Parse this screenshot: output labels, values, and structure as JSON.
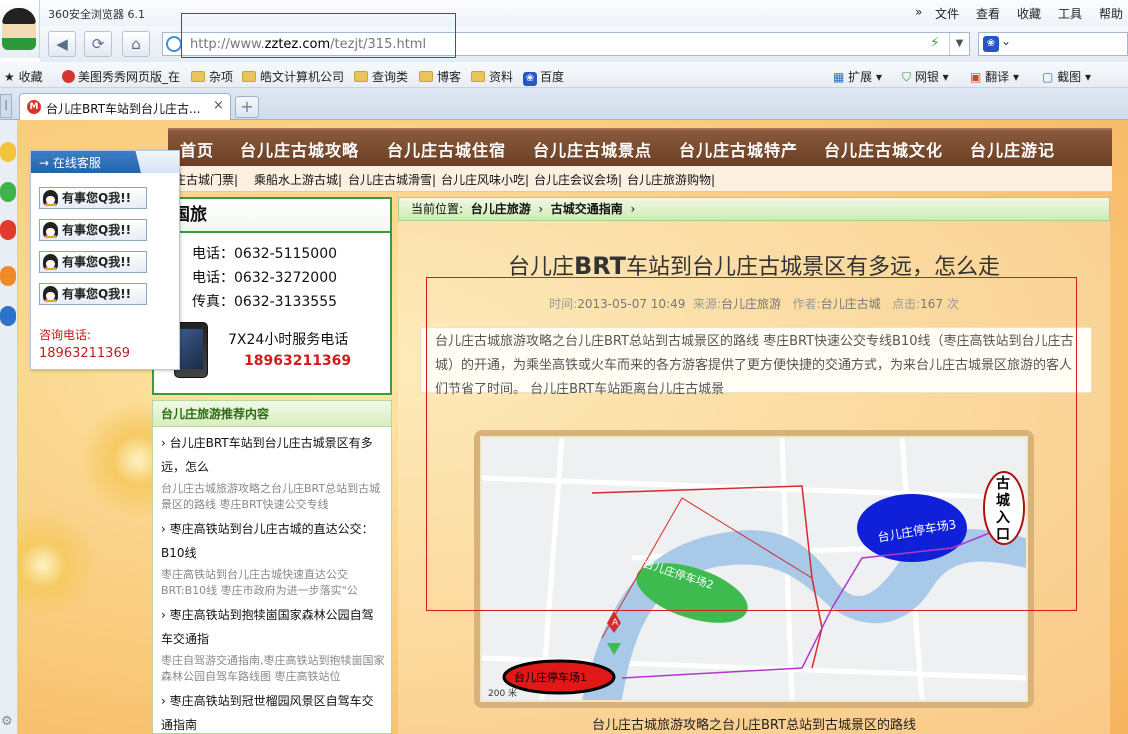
{
  "browser": {
    "app_title": "360安全浏览器 6.1",
    "menu": [
      "文件",
      "查看",
      "收藏",
      "工具",
      "帮助"
    ],
    "menu_chevron": "»",
    "address": {
      "prefix": "http://www.",
      "domain": "zztez.com",
      "path": "/tezjt/315.html"
    },
    "search_dropdown": "⌄",
    "favorites_label": "收藏",
    "favorites": [
      "美图秀秀网页版_在",
      "杂项",
      "皓文计算机公司",
      "查询类",
      "博客",
      "资料",
      "百度"
    ],
    "toolbar_right": [
      "扩展",
      "网银",
      "翻译",
      "截图"
    ],
    "tab_title": "台儿庄BRT车站到台儿庄古...",
    "tab_close": "×",
    "new_tab": "+"
  },
  "site": {
    "top_nav": [
      "首页",
      "台儿庄古城攻略",
      "台儿庄古城住宿",
      "台儿庄古城景点",
      "台儿庄古城特产",
      "台儿庄古城文化",
      "台儿庄游记"
    ],
    "sub_nav": [
      "庄古城门票|",
      "乘船水上游古城|",
      "台儿庄古城滑雪|",
      "台儿庄风味小吃|",
      "台儿庄会议会场|",
      "台儿庄旅游购物|"
    ]
  },
  "customer_service": {
    "title": "→ 在线客服",
    "qq_label": "有事您Q我!!",
    "qq_count": 4,
    "phone_label": "咨询电话:",
    "phone": "18963211369"
  },
  "travel_agency": {
    "title": "商国旅",
    "lines": [
      "电话：0632-5115000",
      "电话：0632-3272000",
      "传真：0632-3133555"
    ],
    "slogan": "7X24小时服务电话",
    "hotline": "18963211369"
  },
  "recommend": {
    "title": "台儿庄旅游推荐内容",
    "items": [
      {
        "title": "› 台儿庄BRT车站到台儿庄古城景区有多远，怎么",
        "desc": "台儿庄古城旅游攻略之台儿庄BRT总站到古城景区的路线 枣庄BRT快速公交专线"
      },
      {
        "title": "› 枣庄高铁站到台儿庄古城的直达公交：B10线",
        "desc": "枣庄高铁站到台儿庄古城快速直达公交BRT:B10线 枣庄市政府为进一步落实\"公"
      },
      {
        "title": "› 枣庄高铁站到抱犊崮国家森林公园自驾车交通指",
        "desc": "枣庄自驾游交通指南,枣庄高铁站到抱犊崮国家森林公园自驾车路线图 枣庄高铁站位"
      },
      {
        "title": "› 枣庄高铁站到冠世榴园风景区自驾车交通指南",
        "desc": ""
      }
    ]
  },
  "article": {
    "breadcrumb_label": "当前位置:",
    "breadcrumb": [
      "台儿庄旅游",
      "›",
      "古城交通指南",
      "›"
    ],
    "title_prefix": "台儿庄",
    "title_brt": "BRT",
    "title_suffix": "车站到台儿庄古城景区有多远，怎么走",
    "meta": {
      "time_label": "时间:",
      "time": "2013-05-07 10:49",
      "source_label": "来源:",
      "source": "台儿庄旅游",
      "author_label": "作者:",
      "author": "台儿庄古城",
      "clicks_label": "点击:",
      "clicks": "167",
      "clicks_unit": "次"
    },
    "summary": "台儿庄古城旅游攻略之台儿庄BRT总站到古城景区的路线 枣庄BRT快速公交专线B10线（枣庄高铁站到台儿庄古城）的开通，为乘坐高铁或火车而来的各方游客提供了更方便快捷的交通方式，为来台儿庄古城景区旅游的客人们节省了时间。 台儿庄BRT车站距离台儿庄古城景",
    "map": {
      "lot1": "台儿庄停车场1",
      "lot2": "台儿庄停车场2",
      "lot3": "台儿庄停车场3",
      "gate": [
        "古",
        "城",
        "入",
        "口"
      ],
      "scale": "200 米",
      "marker": "A"
    },
    "caption": "台儿庄古城旅游攻略之台儿庄BRT总站到古城景区的路线"
  },
  "colors": {
    "nav_brown": "#6b3e24",
    "brand_red": "#d11c1c",
    "green_border": "#3a9a3a"
  }
}
